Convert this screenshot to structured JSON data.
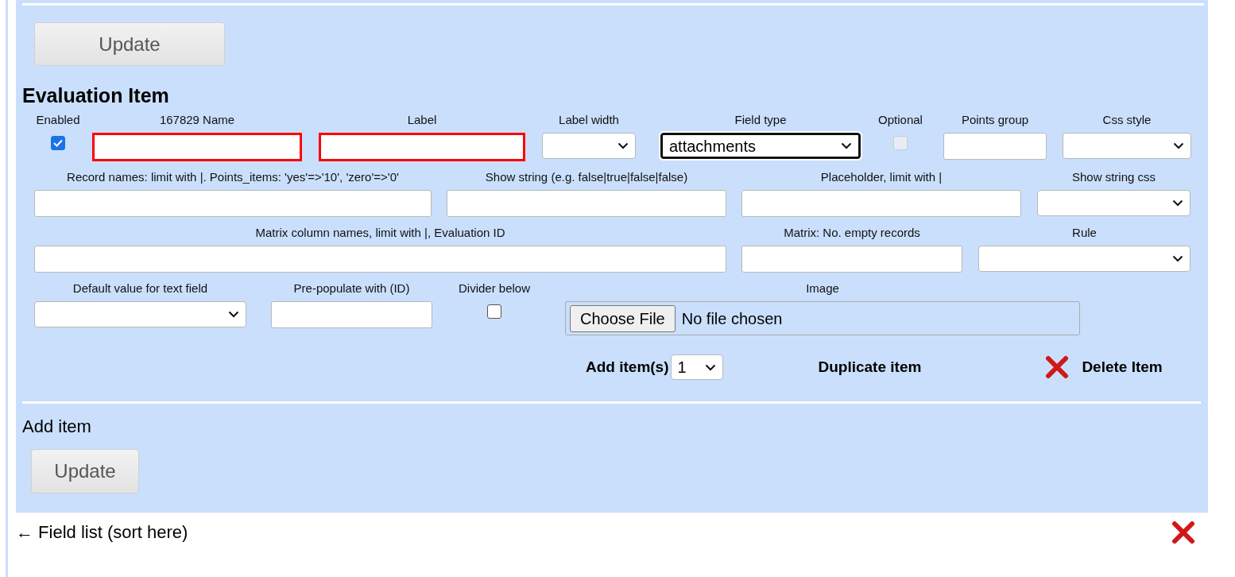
{
  "top_button": "Update",
  "section_title": "Evaluation Item",
  "rows": [
    {
      "fields": [
        {
          "kind": "checkbox",
          "label": "Enabled",
          "checked": true,
          "disabled": false
        },
        {
          "kind": "text",
          "label": "167829 Name",
          "invalid": true
        },
        {
          "kind": "text",
          "label": "Label",
          "invalid": true
        },
        {
          "kind": "select",
          "label": "Label width",
          "focused": false
        },
        {
          "kind": "select",
          "label": "Field type",
          "value": "attachments",
          "focused": true
        },
        {
          "kind": "checkbox",
          "label": "Optional",
          "checked": false,
          "disabled": true
        },
        {
          "kind": "text",
          "label": "Points group",
          "invalid": false
        },
        {
          "kind": "select",
          "label": "Css style",
          "focused": false
        }
      ]
    },
    {
      "fields": [
        {
          "kind": "text",
          "label": "Record names: limit with |. Points_items: 'yes'=>'10', 'zero'=>'0'",
          "invalid": false
        },
        {
          "kind": "text",
          "label": "Show string (e.g. false|true|false|false)",
          "invalid": false
        },
        {
          "kind": "text",
          "label": "Placeholder, limit with |",
          "invalid": false
        },
        {
          "kind": "select",
          "label": "Show string css",
          "focused": false
        }
      ]
    },
    {
      "fields": [
        {
          "kind": "text",
          "label": "Matrix column names, limit with |, Evaluation ID",
          "invalid": false
        },
        {
          "kind": "text",
          "label": "Matrix: No. empty records",
          "invalid": false
        },
        {
          "kind": "select",
          "label": "Rule",
          "focused": false
        }
      ]
    },
    {
      "fields": [
        {
          "kind": "select",
          "label": "Default value for text field",
          "focused": false
        },
        {
          "kind": "text",
          "label": "Pre-populate with (ID)",
          "invalid": false
        },
        {
          "kind": "checkbox",
          "label": "Divider below",
          "checked": false,
          "disabled": false
        },
        {
          "kind": "file",
          "label": "Image",
          "button": "Choose File",
          "status": "No file chosen"
        }
      ]
    }
  ],
  "actions": {
    "add_label": "Add item(s)",
    "add_count": "1",
    "duplicate": "Duplicate item",
    "delete": "Delete Item"
  },
  "add_item_title": "Add item",
  "bottom_button": "Update",
  "field_list_link": "← Field list (sort here)"
}
